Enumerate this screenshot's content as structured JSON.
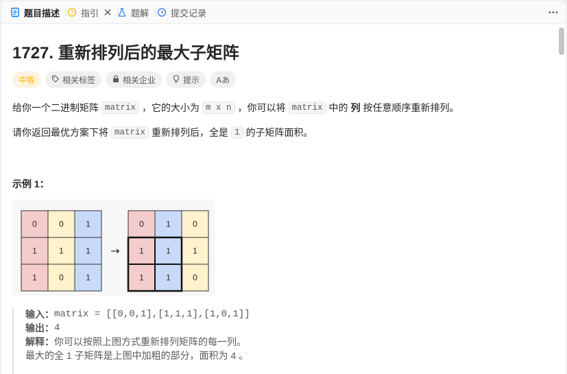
{
  "tabs": [
    {
      "label": "题目描述",
      "icon": "document-icon"
    },
    {
      "label": "指引",
      "icon": "lightbulb-icon"
    },
    {
      "label": "题解",
      "icon": "flask-icon"
    },
    {
      "label": "提交记录",
      "icon": "history-icon"
    }
  ],
  "title": "1727. 重新排列后的最大子矩阵",
  "pills": {
    "difficulty": "中等",
    "tags": "相关标签",
    "companies": "相关企业",
    "hint": "提示",
    "translate": "Aあ"
  },
  "description": {
    "p1": {
      "a": "给你一个二进制矩阵",
      "code1": "matrix",
      "b": "，它的大小为",
      "code2": "m x n",
      "c": "，你可以将",
      "code3": "matrix",
      "d": "中的",
      "strong": "列",
      "e": "按任意顺序重新排列。"
    },
    "p2": {
      "a": "请你返回最优方案下将",
      "code1": "matrix",
      "b": "重新排列后，全是",
      "code2": "1",
      "c": "的子矩阵面积。"
    }
  },
  "example": {
    "title": "示例 1：",
    "figure": {
      "left_grid": [
        [
          "0",
          "0",
          "1"
        ],
        [
          "1",
          "1",
          "1"
        ],
        [
          "1",
          "0",
          "1"
        ]
      ],
      "right_grid": [
        [
          "0",
          "1",
          "0"
        ],
        [
          "1",
          "1",
          "1"
        ],
        [
          "1",
          "1",
          "0"
        ]
      ],
      "arrow": "→"
    },
    "input_label": "输入：",
    "input_value": "matrix = [[0,0,1],[1,1,1],[1,0,1]]",
    "output_label": "输出：",
    "output_value": "4",
    "explain_label": "解释：",
    "explain_value": "你可以按照上图方式重新排列矩阵的每一列。",
    "explain_value2": "最大的全 1 子矩阵是上图中加粗的部分，面积为 4 。"
  },
  "colors": {
    "cell_red": "#f4cccc",
    "cell_yellow": "#fff2cc",
    "cell_blue": "#c9daf8",
    "difficulty": "#ffb700"
  }
}
